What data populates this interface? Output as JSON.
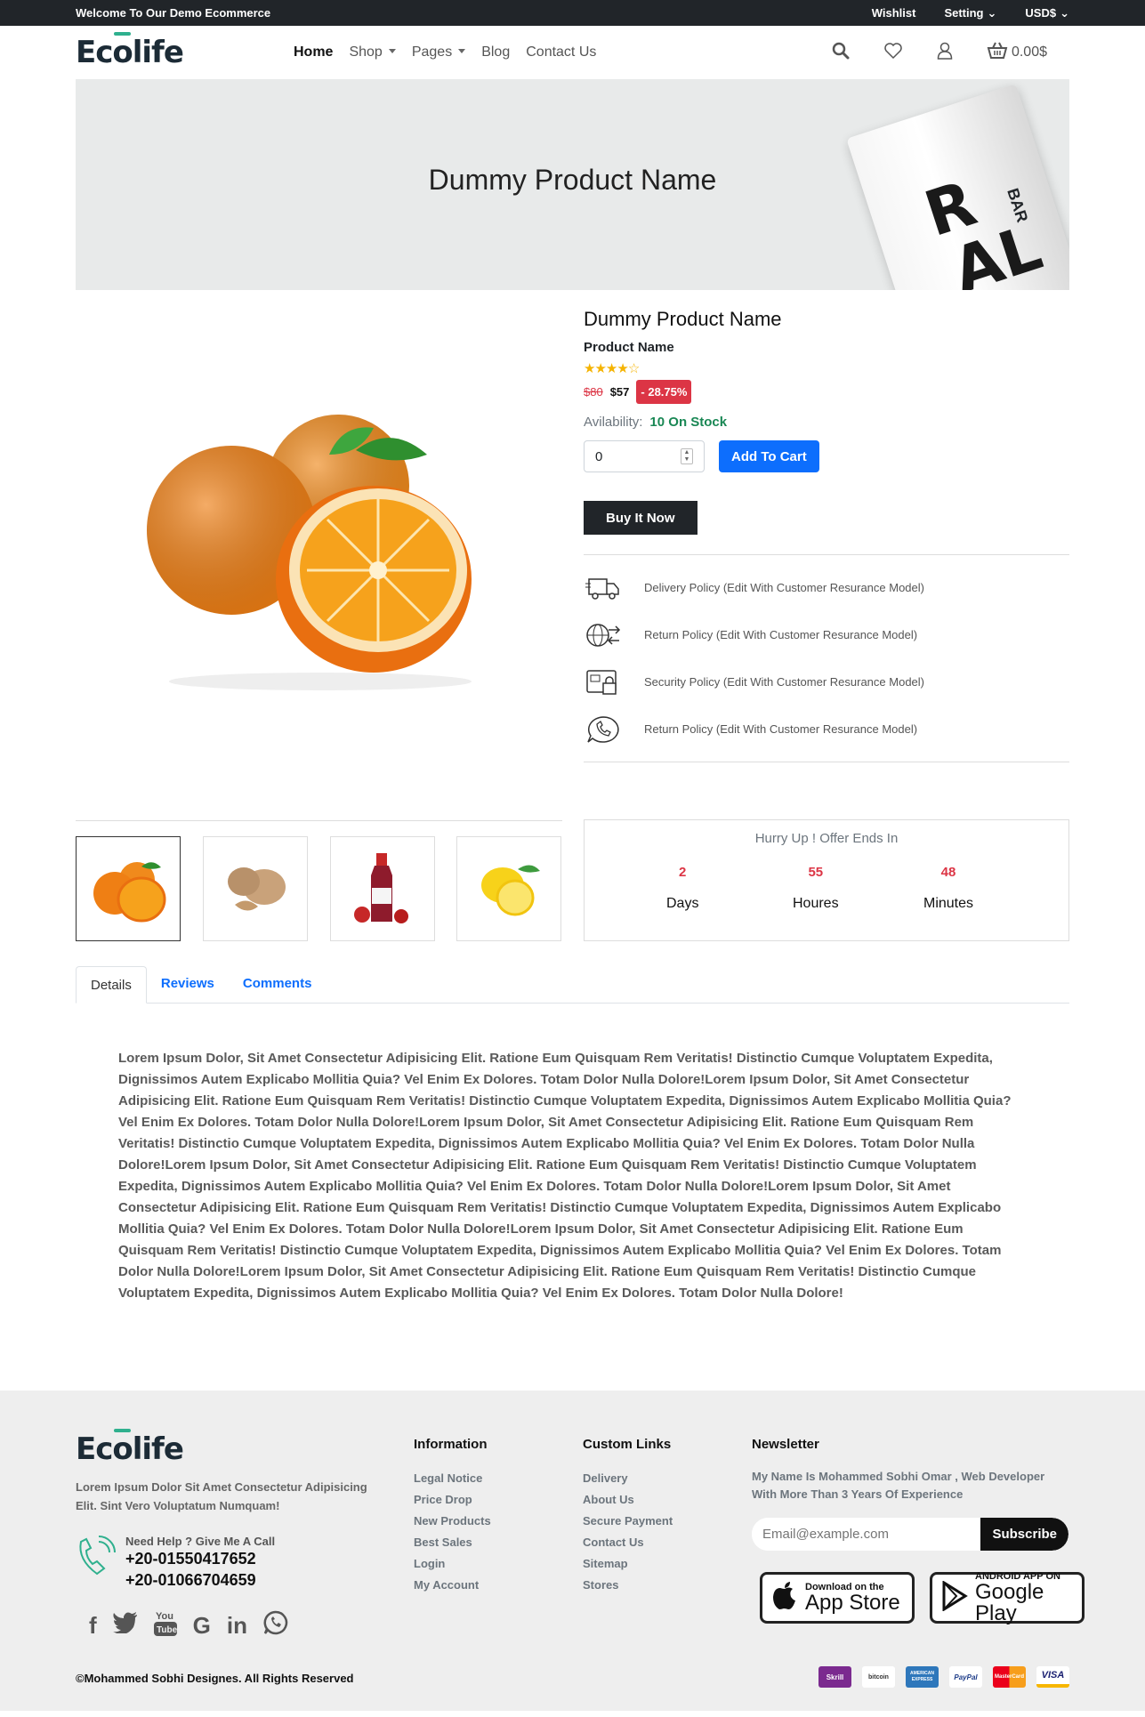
{
  "topbar": {
    "welcome": "Welcome To Our Demo Ecommerce",
    "wishlist": "Wishlist",
    "setting": "Setting",
    "currency": "USD$"
  },
  "nav": {
    "logo": "Ecolife",
    "links": [
      "Home",
      "Shop",
      "Pages",
      "Blog",
      "Contact Us"
    ],
    "cart_total": "0.00$"
  },
  "banner": {
    "title": "Dummy Product Name",
    "pack_letters": [
      "R",
      "AL",
      "BAR"
    ]
  },
  "product": {
    "name": "Dummy Product Name",
    "subname": "Product Name",
    "rating": 4,
    "old_price": "$80",
    "new_price": "$57",
    "discount": "- 28.75%",
    "availability_label": "Avilability:",
    "availability_value": "10 On Stock",
    "qty": "0",
    "add_to_cart": "Add To Cart",
    "buy_now": "Buy It Now",
    "policies": [
      "Delivery Policy (Edit With Customer Resurance Model)",
      "Return Policy (Edit With Customer Resurance Model)",
      "Security Policy (Edit With Customer Resurance Model)",
      "Return Policy (Edit With Customer Resurance Model)"
    ]
  },
  "offer": {
    "title": "Hurry Up ! Offer Ends In",
    "days": "2",
    "days_label": "Days",
    "hours": "55",
    "hours_label": "Houres",
    "minutes": "48",
    "minutes_label": "Minutes"
  },
  "tabs": [
    "Details",
    "Reviews",
    "Comments"
  ],
  "description": "Lorem Ipsum Dolor, Sit Amet Consectetur Adipisicing Elit. Ratione Eum Quisquam Rem Veritatis! Distinctio Cumque Voluptatem Expedita, Dignissimos Autem Explicabo Mollitia Quia? Vel Enim Ex Dolores. Totam Dolor Nulla Dolore!Lorem Ipsum Dolor, Sit Amet Consectetur Adipisicing Elit. Ratione Eum Quisquam Rem Veritatis! Distinctio Cumque Voluptatem Expedita, Dignissimos Autem Explicabo Mollitia Quia? Vel Enim Ex Dolores. Totam Dolor Nulla Dolore!Lorem Ipsum Dolor, Sit Amet Consectetur Adipisicing Elit. Ratione Eum Quisquam Rem Veritatis! Distinctio Cumque Voluptatem Expedita, Dignissimos Autem Explicabo Mollitia Quia? Vel Enim Ex Dolores. Totam Dolor Nulla Dolore!Lorem Ipsum Dolor, Sit Amet Consectetur Adipisicing Elit. Ratione Eum Quisquam Rem Veritatis! Distinctio Cumque Voluptatem Expedita, Dignissimos Autem Explicabo Mollitia Quia? Vel Enim Ex Dolores. Totam Dolor Nulla Dolore!Lorem Ipsum Dolor, Sit Amet Consectetur Adipisicing Elit. Ratione Eum Quisquam Rem Veritatis! Distinctio Cumque Voluptatem Expedita, Dignissimos Autem Explicabo Mollitia Quia? Vel Enim Ex Dolores. Totam Dolor Nulla Dolore!Lorem Ipsum Dolor, Sit Amet Consectetur Adipisicing Elit. Ratione Eum Quisquam Rem Veritatis! Distinctio Cumque Voluptatem Expedita, Dignissimos Autem Explicabo Mollitia Quia? Vel Enim Ex Dolores. Totam Dolor Nulla Dolore!Lorem Ipsum Dolor, Sit Amet Consectetur Adipisicing Elit. Ratione Eum Quisquam Rem Veritatis! Distinctio Cumque Voluptatem Expedita, Dignissimos Autem Explicabo Mollitia Quia? Vel Enim Ex Dolores. Totam Dolor Nulla Dolore!",
  "footer": {
    "logo": "Ecolife",
    "about": "Lorem Ipsum Dolor Sit Amet Consectetur Adipisicing Elit. Sint Vero Voluptatum Numquam!",
    "help": "Need Help ? Give Me A Call",
    "phone1": "+20-01550417652",
    "phone2": "+20-01066704659",
    "information_title": "Information",
    "information": [
      "Legal Notice",
      "Price Drop",
      "New Products",
      "Best Sales",
      "Login",
      "My Account"
    ],
    "custom_title": "Custom Links",
    "custom": [
      "Delivery",
      "About Us",
      "Secure Payment",
      "Contact Us",
      "Sitemap",
      "Stores"
    ],
    "newsletter_title": "Newsletter",
    "newsletter_text": "My Name Is Mohammed Sobhi Omar , Web Developer With More Than 3 Years Of Experience",
    "email_placeholder": "Email@example.com",
    "subscribe": "Subscribe",
    "app_store_small": "Download on the",
    "app_store_big": "App Store",
    "google_small": "ANDROID APP ON",
    "google_big": "Google Play",
    "copyright": "©Mohammed Sobhi Designes. All Rights Reserved",
    "payments": [
      "Skrill",
      "bitcoin",
      "AMERICAN EXPRESS",
      "PayPal",
      "MasterCard",
      "VISA"
    ],
    "social_icons": [
      "facebook-icon",
      "twitter-icon",
      "youtube-icon",
      "google-icon",
      "linkedin-icon",
      "whatsapp-icon"
    ]
  },
  "colors": {
    "accent": "#0d6efd",
    "danger": "#dc3545",
    "success": "#198754",
    "dark": "#212529",
    "brand_green": "#2fb08e"
  }
}
